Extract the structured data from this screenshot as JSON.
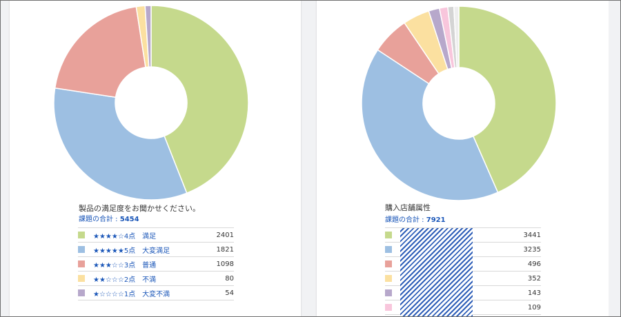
{
  "charts": [
    {
      "title": "製品の満足度をお聞かせください。",
      "total_label": "課題の合計 : ",
      "total_value": "5454",
      "legend": [
        {
          "label": "★★★★☆4点　満足",
          "value": "2401"
        },
        {
          "label": "★★★★★5点　大変満足",
          "value": "1821"
        },
        {
          "label": "★★★☆☆3点　普通",
          "value": "1098"
        },
        {
          "label": "★★☆☆☆2点　不満",
          "value": "80"
        },
        {
          "label": "★☆☆☆☆1点　大変不満",
          "value": "54"
        }
      ]
    },
    {
      "title": "購入店舗属性",
      "total_label": "課題の合計 : ",
      "total_value": "7921",
      "legend": [
        {
          "label": "",
          "value": "3441"
        },
        {
          "label": "",
          "value": "3235"
        },
        {
          "label": "",
          "value": "496"
        },
        {
          "label": "",
          "value": "352"
        },
        {
          "label": "",
          "value": "143"
        },
        {
          "label": "",
          "value": "109"
        }
      ]
    }
  ],
  "chart_data": [
    {
      "type": "pie",
      "title": "製品の満足度をお聞かせください。",
      "categories": [
        "★★★★☆4点　満足",
        "★★★★★5点　大変満足",
        "★★★☆☆3点　普通",
        "★★☆☆☆2点　不満",
        "★☆☆☆☆1点　大変不満"
      ],
      "values": [
        2401,
        1821,
        1098,
        80,
        54
      ],
      "colors": [
        "#c5d98c",
        "#9dbfe2",
        "#e8a19a",
        "#fbe0a0",
        "#b7a8cb"
      ],
      "legend_position": "bottom"
    },
    {
      "type": "pie",
      "title": "購入店舗属性",
      "categories": [],
      "values": [
        3441,
        3235,
        496,
        352,
        143,
        109,
        80,
        65
      ],
      "colors": [
        "#c5d98c",
        "#9dbfe2",
        "#e8a19a",
        "#fbe0a0",
        "#b7a8cb",
        "#f8c6dc",
        "#d4d4d4",
        "#eeeeee"
      ],
      "legend_position": "bottom"
    }
  ]
}
